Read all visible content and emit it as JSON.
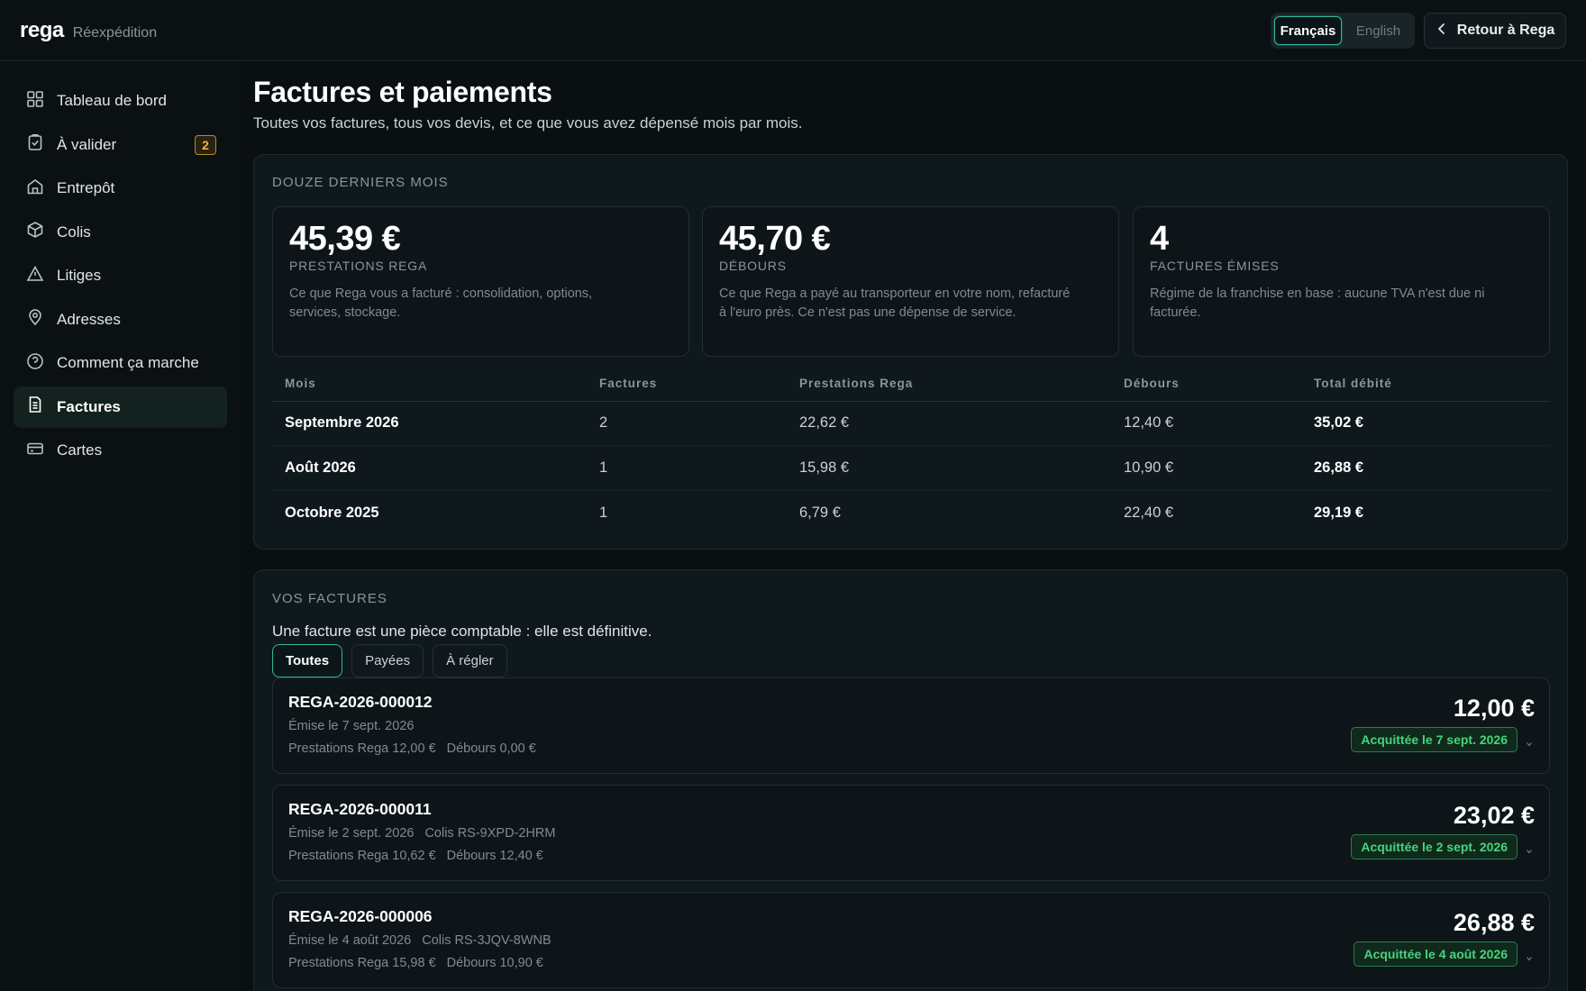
{
  "brand": {
    "logo": "rega",
    "subtitle": "Réexpédition"
  },
  "header": {
    "languages": [
      {
        "label": "Français",
        "active": true
      },
      {
        "label": "English",
        "active": false
      }
    ],
    "back_label": "Retour à Rega"
  },
  "sidebar": {
    "items": [
      {
        "label": "Tableau de bord",
        "icon": "dashboard-grid-icon"
      },
      {
        "label": "À valider",
        "icon": "clipboard-check-icon",
        "badge": "2"
      },
      {
        "label": "Entrepôt",
        "icon": "warehouse-icon"
      },
      {
        "label": "Colis",
        "icon": "package-icon"
      },
      {
        "label": "Litiges",
        "icon": "warning-triangle-icon"
      },
      {
        "label": "Adresses",
        "icon": "map-pin-icon"
      },
      {
        "label": "Comment ça marche",
        "icon": "help-circle-icon"
      },
      {
        "label": "Factures",
        "icon": "document-icon",
        "active": true
      },
      {
        "label": "Cartes",
        "icon": "credit-card-icon"
      }
    ]
  },
  "page": {
    "title": "Factures et paiements",
    "subtitle": "Toutes vos factures, tous vos devis, et ce que vous avez dépensé mois par mois."
  },
  "summary": {
    "label": "Douze derniers mois",
    "cards": [
      {
        "value": "45,39 €",
        "label": "Prestations Rega",
        "desc": "Ce que Rega vous a facturé : consolidation, options, services, stockage."
      },
      {
        "value": "45,70 €",
        "label": "Débours",
        "desc": "Ce que Rega a payé au transporteur en votre nom, refacturé à l'euro près. Ce n'est pas une dépense de service."
      },
      {
        "value": "4",
        "label": "Factures émises",
        "desc": "Régime de la franchise en base : aucune TVA n'est due ni facturée."
      }
    ],
    "table": {
      "headers": [
        "Mois",
        "Factures",
        "Prestations Rega",
        "Débours",
        "Total débité"
      ],
      "rows": [
        [
          "Septembre 2026",
          "2",
          "22,62 €",
          "12,40 €",
          "35,02 €"
        ],
        [
          "Août 2026",
          "1",
          "15,98 €",
          "10,90 €",
          "26,88 €"
        ],
        [
          "Octobre 2025",
          "1",
          "6,79 €",
          "22,40 €",
          "29,19 €"
        ]
      ]
    }
  },
  "invoices": {
    "label": "Vos factures",
    "intro": "Une facture est une pièce comptable : elle est définitive.",
    "filters": [
      {
        "label": "Toutes",
        "active": true
      },
      {
        "label": "Payées",
        "active": false
      },
      {
        "label": "À régler",
        "active": false
      }
    ],
    "items": [
      {
        "number": "REGA-2026-000012",
        "issued": "Émise le 7 sept. 2026",
        "parcel": "",
        "services": "Prestations Rega 12,00 €",
        "disbursements": "Débours 0,00 €",
        "total": "12,00 €",
        "status": "Acquittée le 7 sept. 2026"
      },
      {
        "number": "REGA-2026-000011",
        "issued": "Émise le 2 sept. 2026",
        "parcel": "Colis RS-9XPD-2HRM",
        "services": "Prestations Rega 10,62 €",
        "disbursements": "Débours 12,40 €",
        "total": "23,02 €",
        "status": "Acquittée le 2 sept. 2026"
      },
      {
        "number": "REGA-2026-000006",
        "issued": "Émise le 4 août 2026",
        "parcel": "Colis RS-3JQV-8WNB",
        "services": "Prestations Rega 15,98 €",
        "disbursements": "Débours 10,90 €",
        "total": "26,88 €",
        "status": "Acquittée le 4 août 2026"
      }
    ]
  },
  "colors": {
    "accent": "#2fb89a",
    "success": "#4ad27c",
    "warning": "#f0b545",
    "background": "#0a0f12"
  }
}
